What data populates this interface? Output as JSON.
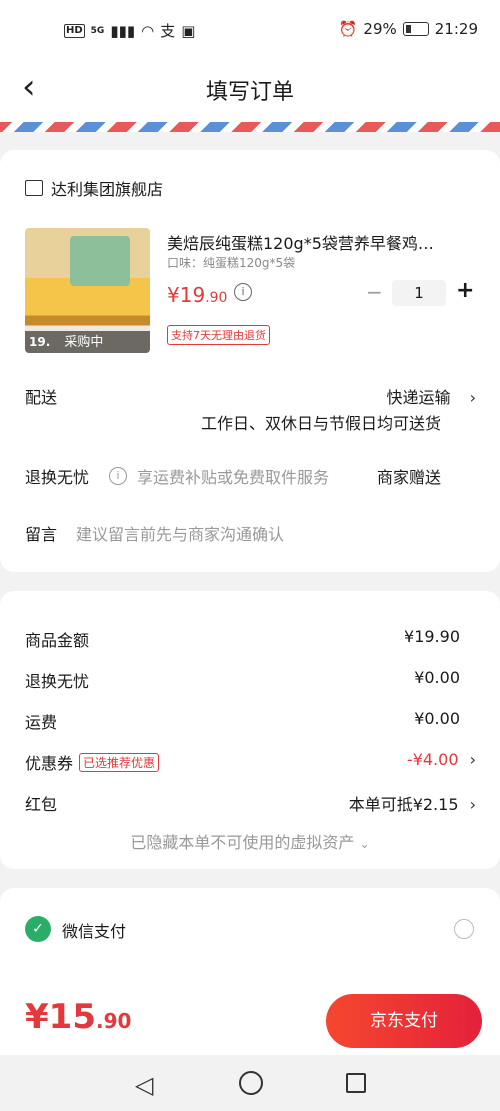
{
  "status_bar": {
    "hd": "HD",
    "network": "5G",
    "carrier_icon": "支",
    "battery": "29%",
    "time": "21:29"
  },
  "nav": {
    "title": "填写订单"
  },
  "store": {
    "name": "达利集团旗舰店"
  },
  "product": {
    "name": "美焙辰纯蛋糕120g*5袋营养早餐鸡…",
    "spec": "口味：纯蛋糕120g*5袋",
    "price_int": "¥19",
    "price_dec": ".90",
    "quantity": "1",
    "badge": "支持7天无理由退货",
    "thumb_tag": "采购中",
    "thumb_price": "19."
  },
  "delivery": {
    "label": "配送",
    "method": "快递运输",
    "note": "工作日、双休日与节假日均可送货"
  },
  "return_service": {
    "label": "退换无忧",
    "desc": "享运费补贴或免费取件服务",
    "value": "商家赠送"
  },
  "message": {
    "label": "留言",
    "placeholder": "建议留言前先与商家沟通确认"
  },
  "summary": {
    "goods_label": "商品金额",
    "goods_value": "¥19.90",
    "return_label": "退换无忧",
    "return_value": "¥0.00",
    "shipping_label": "运费",
    "shipping_value": "¥0.00",
    "coupon_label": "优惠券",
    "coupon_tag": "已选推荐优惠",
    "coupon_value": "-¥4.00",
    "redpacket_label": "红包",
    "redpacket_value": "本单可抵¥2.15",
    "hidden_assets": "已隐藏本单不可使用的虚拟资产"
  },
  "payment": {
    "wechat_label": "微信支付"
  },
  "bottom": {
    "total_int": "¥15",
    "total_dec": ".90",
    "pay_button": "京东支付"
  },
  "colors": {
    "accent": "#e4393c",
    "wechat_green": "#2aae67"
  }
}
